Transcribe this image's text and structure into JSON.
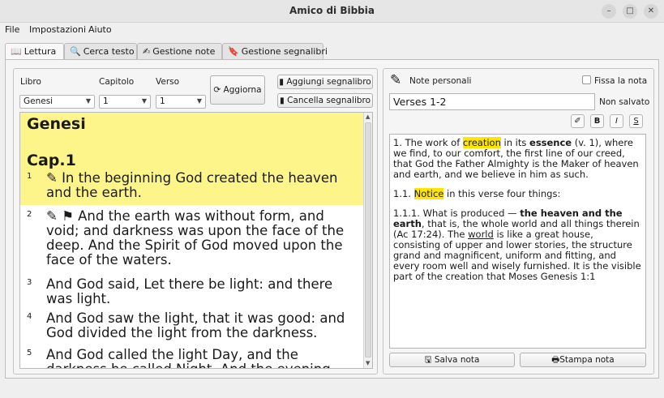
{
  "window": {
    "title": "Amico di Bibbia"
  },
  "menu": {
    "file": "File",
    "settings": "Impostazioni",
    "help": "Aiuto"
  },
  "tabs": {
    "reading": "Lettura",
    "search": "Cerca testo",
    "notes": "Gestione note",
    "bookmarks": "Gestione segnalibri"
  },
  "selectors": {
    "book_label": "Libro",
    "book_value": "Genesi",
    "chapter_label": "Capitolo",
    "chapter_value": "1",
    "verse_label": "Verso",
    "verse_value": "1",
    "refresh": "Aggiorna",
    "add_bookmark": "Aggiungi segnalibro",
    "remove_bookmark": "Cancella segnalibro"
  },
  "reader": {
    "book": "Genesi",
    "chapter": "Cap.1",
    "verses": [
      {
        "num": "1",
        "text": "✎ In the beginning God created the heaven and the earth."
      },
      {
        "num": "2",
        "text": "✎ ⚑ And the earth was without form, and void; and darkness was upon the face of the deep. And the Spirit of God moved upon the face of the waters."
      },
      {
        "num": "3",
        "text": "And God said, Let there be light: and there was light."
      },
      {
        "num": "4",
        "text": "And God saw the light, that it was good: and God divided the light from the darkness."
      },
      {
        "num": "5",
        "text": "And God called the light Day, and the darkness he called Night. And the evening"
      }
    ]
  },
  "notes": {
    "header": "Note personali",
    "pin_label": "Fissa la nota",
    "title_value": "Verses 1-2",
    "status": "Non salvato",
    "fmt_bold": "B",
    "fmt_italic": "I",
    "fmt_strike": "S",
    "p1_a": "1. The work of ",
    "p1_mark": "creation",
    "p1_b": " in its ",
    "p1_bold": "essence",
    "p1_c": " (v. 1), where we find, to our comfort, the first line of our creed, that God the Father Almighty is the Maker of heaven and earth, and we believe in him as such.",
    "p2_a": "1.1. ",
    "p2_mark": "Notice",
    "p2_b": " in this verse four things:",
    "p3_a": "1.1.1. What is produced — ",
    "p3_bold": "the heaven and the earth",
    "p3_b": ", that is, the whole world and all things therein (Ac 17:24). The ",
    "p3_u": "world",
    "p3_c": " is like a great house, consisting of upper and lower stories, the structure grand and magnificent, uniform and fitting, and every room well and wisely furnished. It is the visible part of the creation that Moses Genesis 1:1",
    "save": "Salva nota",
    "print": "Stampa nota"
  }
}
